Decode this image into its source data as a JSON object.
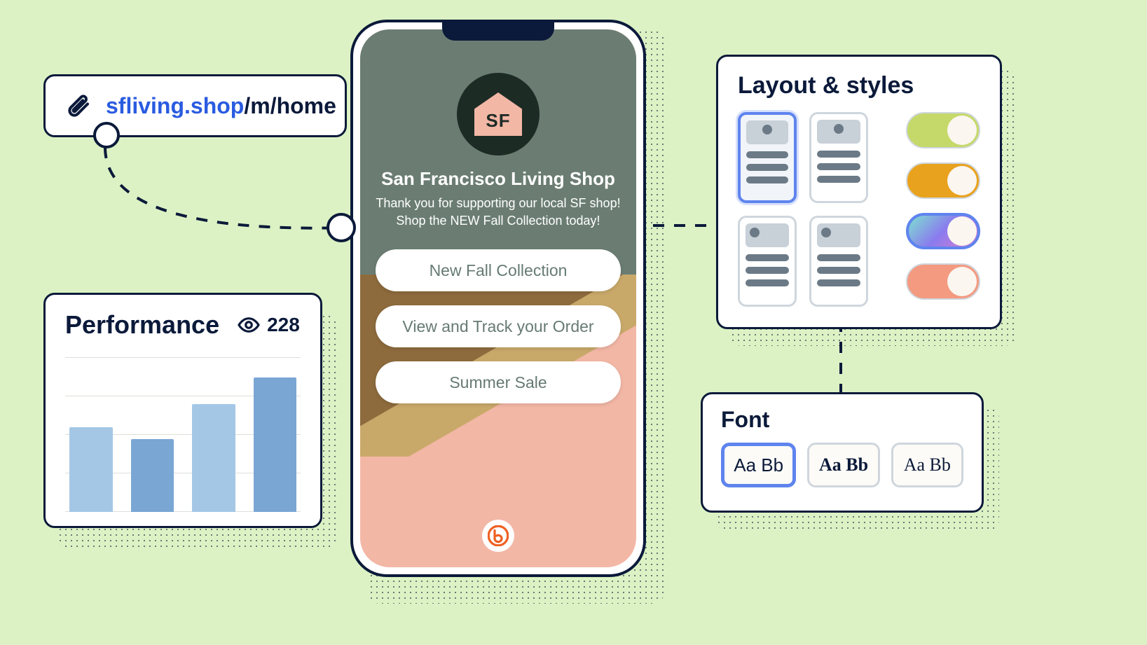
{
  "url": {
    "domain": "sfliving.shop",
    "path": "/m/home"
  },
  "phone": {
    "logo_text": "SF",
    "title": "San Francisco Living Shop",
    "subtitle_line1": "Thank you for supporting our local SF shop!",
    "subtitle_line2": "Shop the NEW Fall Collection today!",
    "links": [
      "New Fall Collection",
      "View and Track your Order",
      "Summer Sale"
    ]
  },
  "performance": {
    "title": "Performance",
    "views": "228"
  },
  "styles_panel": {
    "title": "Layout & styles",
    "toggle_colors": [
      {
        "fill": "#c5d96a",
        "selected": false
      },
      {
        "fill": "#e8a21d",
        "selected": false
      },
      {
        "fill": "linear-gradient(135deg,#7de0d0,#8a7bee,#e07bd0)",
        "selected": true
      },
      {
        "fill": "#f39a80",
        "selected": false
      }
    ]
  },
  "font_panel": {
    "title": "Font",
    "sample": "Aa Bb"
  },
  "chart_data": {
    "type": "bar",
    "title": "Performance",
    "categories": [
      "",
      "",
      "",
      ""
    ],
    "values": [
      110,
      95,
      140,
      175
    ],
    "colors": [
      "#a5c7e6",
      "#7aa6d4",
      "#a5c7e6",
      "#7aa6d4"
    ],
    "ylim": [
      0,
      200
    ],
    "gridlines": [
      0,
      50,
      100,
      150,
      200
    ]
  }
}
